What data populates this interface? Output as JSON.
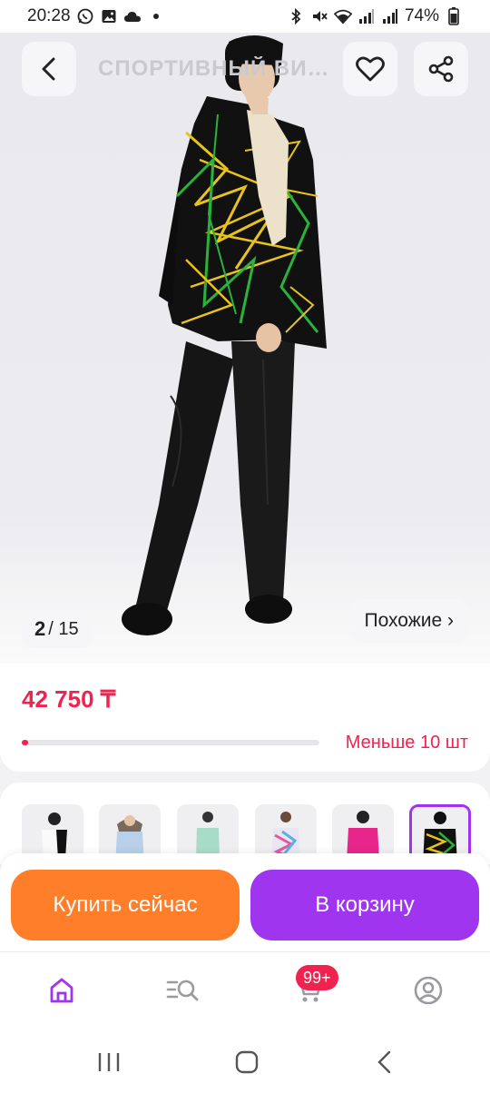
{
  "status_bar": {
    "time": "20:28",
    "battery": "74%",
    "left_icons": [
      "whatsapp-icon",
      "gallery-icon",
      "cloud-icon",
      "dot-icon"
    ],
    "right_icons": [
      "bluetooth-icon",
      "mute-icon",
      "wifi-icon",
      "signal-icon",
      "signal-icon",
      "battery-icon"
    ]
  },
  "header": {
    "title": "СПОРТИВНЫЙ ВИД...",
    "back_icon": "chevron-left-icon",
    "favorite_icon": "heart-icon",
    "share_icon": "share-icon"
  },
  "gallery": {
    "current": "2",
    "total": "/ 15",
    "similar_label": "Похожие ›"
  },
  "product": {
    "price": "42 750 ₸",
    "stock_label": "Меньше 10 шт",
    "stock_level": 0.02,
    "accent_color": "#f0224f"
  },
  "variants": [
    {
      "name": "white-black",
      "active": false
    },
    {
      "name": "light-blue",
      "active": false
    },
    {
      "name": "mint",
      "active": false
    },
    {
      "name": "print-pastel",
      "active": false
    },
    {
      "name": "pink",
      "active": false
    },
    {
      "name": "black-yellow-print",
      "active": true
    }
  ],
  "actions": {
    "buy_now": "Купить сейчас",
    "add_to_cart": "В корзину",
    "buy_color": "#fe7e29",
    "cart_color": "#a035f0"
  },
  "bottom_nav": {
    "items": [
      "home-icon",
      "catalog-search-icon",
      "cart-icon",
      "profile-icon"
    ],
    "cart_badge": "99+",
    "active_color": "#a035f0"
  },
  "system_nav": [
    "recent-apps-icon",
    "home-button-icon",
    "back-icon"
  ]
}
